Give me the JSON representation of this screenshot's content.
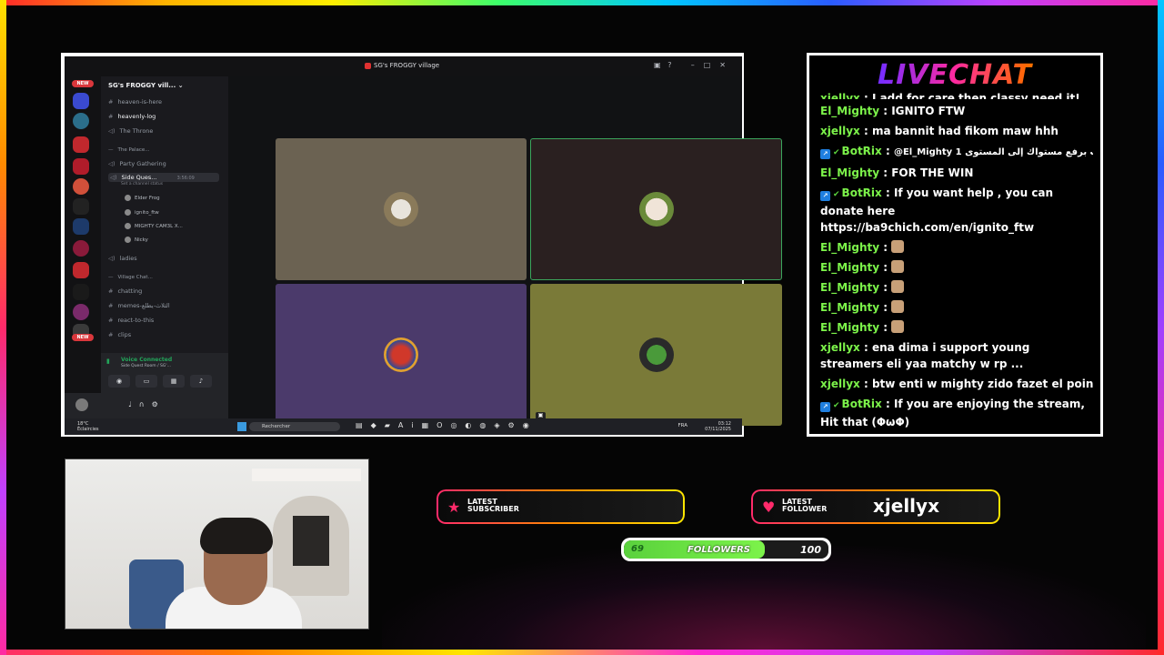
{
  "discord": {
    "window_title": "SG's FROGGY village",
    "server_name": "SG's FROGGY vill...",
    "new_badge": "NEW",
    "channels": [
      {
        "label": "heaven-is-here"
      },
      {
        "label": "heavenly-log"
      },
      {
        "label": "The Throne"
      },
      {
        "label": "The Palace..."
      },
      {
        "label": "Party Gathering"
      },
      {
        "label": "Side Ques...",
        "timer": "3:56:09",
        "status": "Set a channel status"
      }
    ],
    "voice_members": [
      "Elder Frog",
      "ignito_ftw",
      "MIGHTY CAM3L X...",
      "Nicky"
    ],
    "more_channels": [
      {
        "label": "ladies"
      },
      {
        "label": "Village Chat..."
      },
      {
        "label": "chatting"
      },
      {
        "label": "memes-الثلاث-يطلع"
      },
      {
        "label": "react-to-this"
      },
      {
        "label": "clips"
      }
    ],
    "voice_status": "Voice Connected",
    "voice_room": "Side Quest Room / SG'...",
    "taskbar": {
      "temperature": "18°C",
      "weather": "Éclaircies",
      "search_placeholder": "Rechercher",
      "language": "FRA",
      "time": "03:12",
      "date": "07/11/2025"
    }
  },
  "livechat": {
    "title": "LIVECHAT",
    "messages": [
      {
        "user": "xjellyx",
        "text": "I add for care then classy need it!",
        "bot": false
      },
      {
        "user": "El_Mighty",
        "text": "IGNITO FTW",
        "bot": false
      },
      {
        "user": "xjellyx",
        "text": "ma bannit had fikom maw hhh",
        "bot": false
      },
      {
        "user": "BotRix",
        "text": "@El_Mighty 1 قمت برفع مستواك إلى المستوى",
        "bot": true
      },
      {
        "user": "El_Mighty",
        "text": "FOR THE WIN",
        "bot": false
      },
      {
        "user": "BotRix",
        "text": "If you want help , you can donate here https://ba9chich.com/en/ignito_ftw",
        "bot": true
      },
      {
        "user": "El_Mighty",
        "text": "",
        "bot": false,
        "emote": true
      },
      {
        "user": "El_Mighty",
        "text": "",
        "bot": false,
        "emote": true
      },
      {
        "user": "El_Mighty",
        "text": "",
        "bot": false,
        "emote": true
      },
      {
        "user": "El_Mighty",
        "text": "",
        "bot": false,
        "emote": true
      },
      {
        "user": "El_Mighty",
        "text": "",
        "bot": false,
        "emote": true
      },
      {
        "user": "xjellyx",
        "text": "ena dima i support young streamers eli yaa matchy w rp ...",
        "bot": false
      },
      {
        "user": "xjellyx",
        "text": "btw enti w mighty zido fazet el points w kick",
        "bot": false
      },
      {
        "user": "BotRix",
        "text": "If you are enjoying the stream, Hit that (ΦωΦ)",
        "bot": true
      }
    ]
  },
  "latest_subscriber": {
    "label_line1": "LATEST",
    "label_line2": "SUBSCRIBER",
    "value": ""
  },
  "latest_follower": {
    "label_line1": "LATEST",
    "label_line2": "FOLLOWER",
    "value": "xjellyx"
  },
  "followers_goal": {
    "current": "69",
    "label": "FOLLOWERS",
    "goal": "100",
    "progress": 0.69
  },
  "colors": {
    "accent_green": "#7cf34a",
    "accent_pink": "#ff2a6a"
  }
}
